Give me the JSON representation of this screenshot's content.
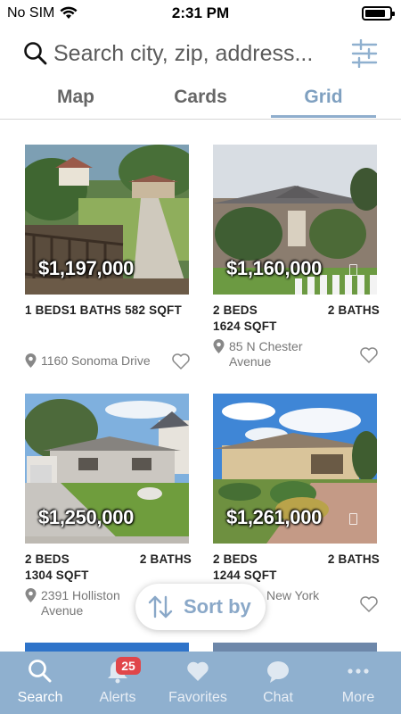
{
  "status_bar": {
    "carrier": "No SIM",
    "time": "2:31 PM"
  },
  "search": {
    "placeholder": "Search city, zip, address..."
  },
  "tabs": [
    {
      "label": "Map"
    },
    {
      "label": "Cards"
    },
    {
      "label": "Grid",
      "active": true
    }
  ],
  "listings": [
    {
      "price": "$1,197,000",
      "beds": "1 BEDS",
      "baths": "1 BATHS",
      "sqft": "582 SQFT",
      "address": "1160 Sonoma Drive"
    },
    {
      "price": "$1,160,000",
      "beds": "2 BEDS",
      "baths": "2 BATHS",
      "sqft": "1624 SQFT",
      "address": "85 N Chester Avenue"
    },
    {
      "price": "$1,250,000",
      "beds": "2 BEDS",
      "baths": "2 BATHS",
      "sqft": "1304 SQFT",
      "address": "2391 Holliston Avenue"
    },
    {
      "price": "$1,261,000",
      "beds": "2 BEDS",
      "baths": "2 BATHS",
      "sqft": "1244 SQFT",
      "address": "New York"
    }
  ],
  "sort": {
    "label": "Sort by"
  },
  "tab_bar": {
    "items": [
      {
        "label": "Search",
        "icon": "search-icon",
        "active": true
      },
      {
        "label": "Alerts",
        "icon": "bell-icon",
        "badge": "25"
      },
      {
        "label": "Favorites",
        "icon": "heart-icon"
      },
      {
        "label": "Chat",
        "icon": "chat-bubble-icon"
      },
      {
        "label": "More",
        "icon": "more-dots-icon"
      }
    ]
  },
  "colors": {
    "accent": "#8fb0cf",
    "tab_active": "#7fa0c0",
    "badge": "#e0464a"
  }
}
